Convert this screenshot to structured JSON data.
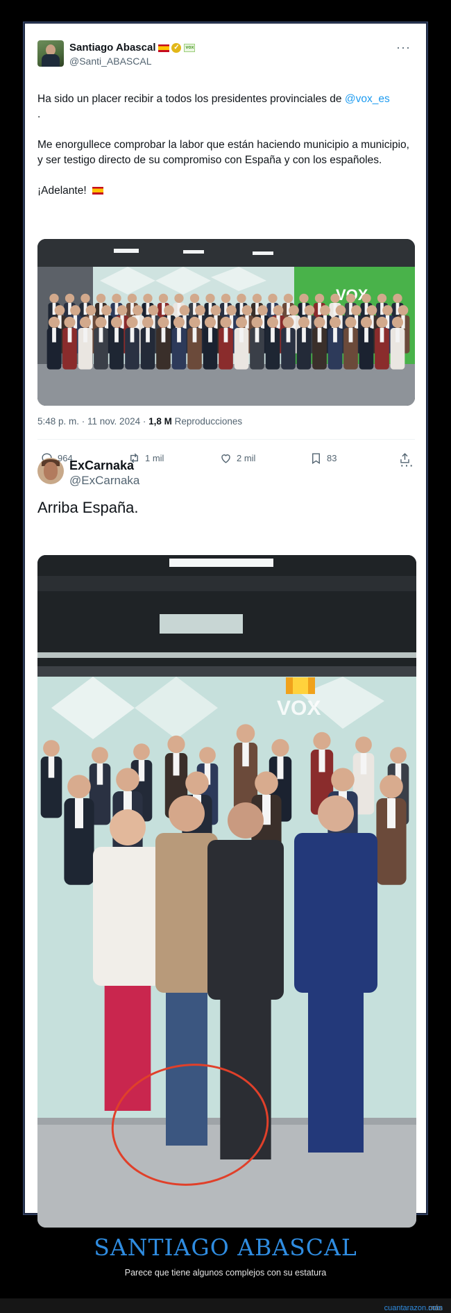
{
  "tweet1": {
    "name": "Santiago Abascal",
    "handle": "@Santi_ABASCAL",
    "text_line1": "Ha sido un placer recibir a todos los presidentes provinciales de ",
    "mention": "@vox_es",
    "text_line1_end": ".",
    "text_para2": "Me enorgullece comprobar la labor que están haciendo municipio a municipio, y ser testigo directo de su compromiso con España y con los españoles.",
    "text_para3": "¡Adelante!",
    "timestamp": "5:48 p. m. · 11 nov. 2024 · ",
    "views": "1,8 M",
    "views_label": " Reproducciones",
    "replies": "964",
    "reposts": "1 mil",
    "likes": "2 mil",
    "bookmarks": "83",
    "photo_sign": "VOX"
  },
  "tweet2": {
    "name": "ExCarnaka",
    "handle": "@ExCarnaka",
    "text": "Arriba España.",
    "photo_sign": "VOX"
  },
  "caption": {
    "title": "SANTIAGO ABASCAL",
    "subtitle": "Parece que tiene algunos complejos con su estatura"
  },
  "footer": {
    "prefix": "más en ",
    "site": "cuantarazon.com"
  },
  "colors": {
    "link": "#1d9bf0",
    "caption_title": "#2f8ce0",
    "vox_green": "#5dbb3a",
    "annotation_red": "#e0402a"
  },
  "icons": [
    "reply-icon",
    "repost-icon",
    "like-icon",
    "bookmark-icon",
    "share-icon",
    "more-icon",
    "verified-icon"
  ]
}
